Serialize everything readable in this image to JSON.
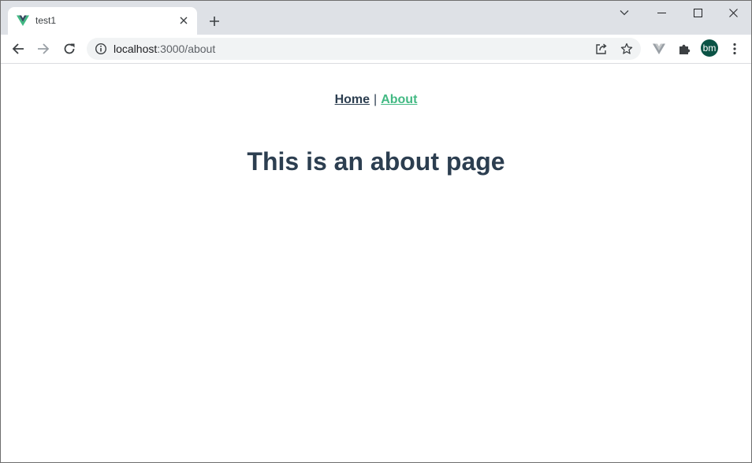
{
  "browser": {
    "tab": {
      "title": "test1",
      "favicon": "vue-logo-icon"
    },
    "address_bar": {
      "host": "localhost",
      "path": ":3000/about"
    },
    "profile_initials": "bm"
  },
  "page": {
    "nav": {
      "home_label": "Home",
      "separator": "|",
      "about_label": "About"
    },
    "heading": "This is an about page"
  },
  "colors": {
    "text": "#2c3e50",
    "active_link": "#42b983",
    "avatar_bg": "#0b5345",
    "tabstrip_bg": "#dee1e6",
    "omnibox_bg": "#f1f3f4"
  }
}
